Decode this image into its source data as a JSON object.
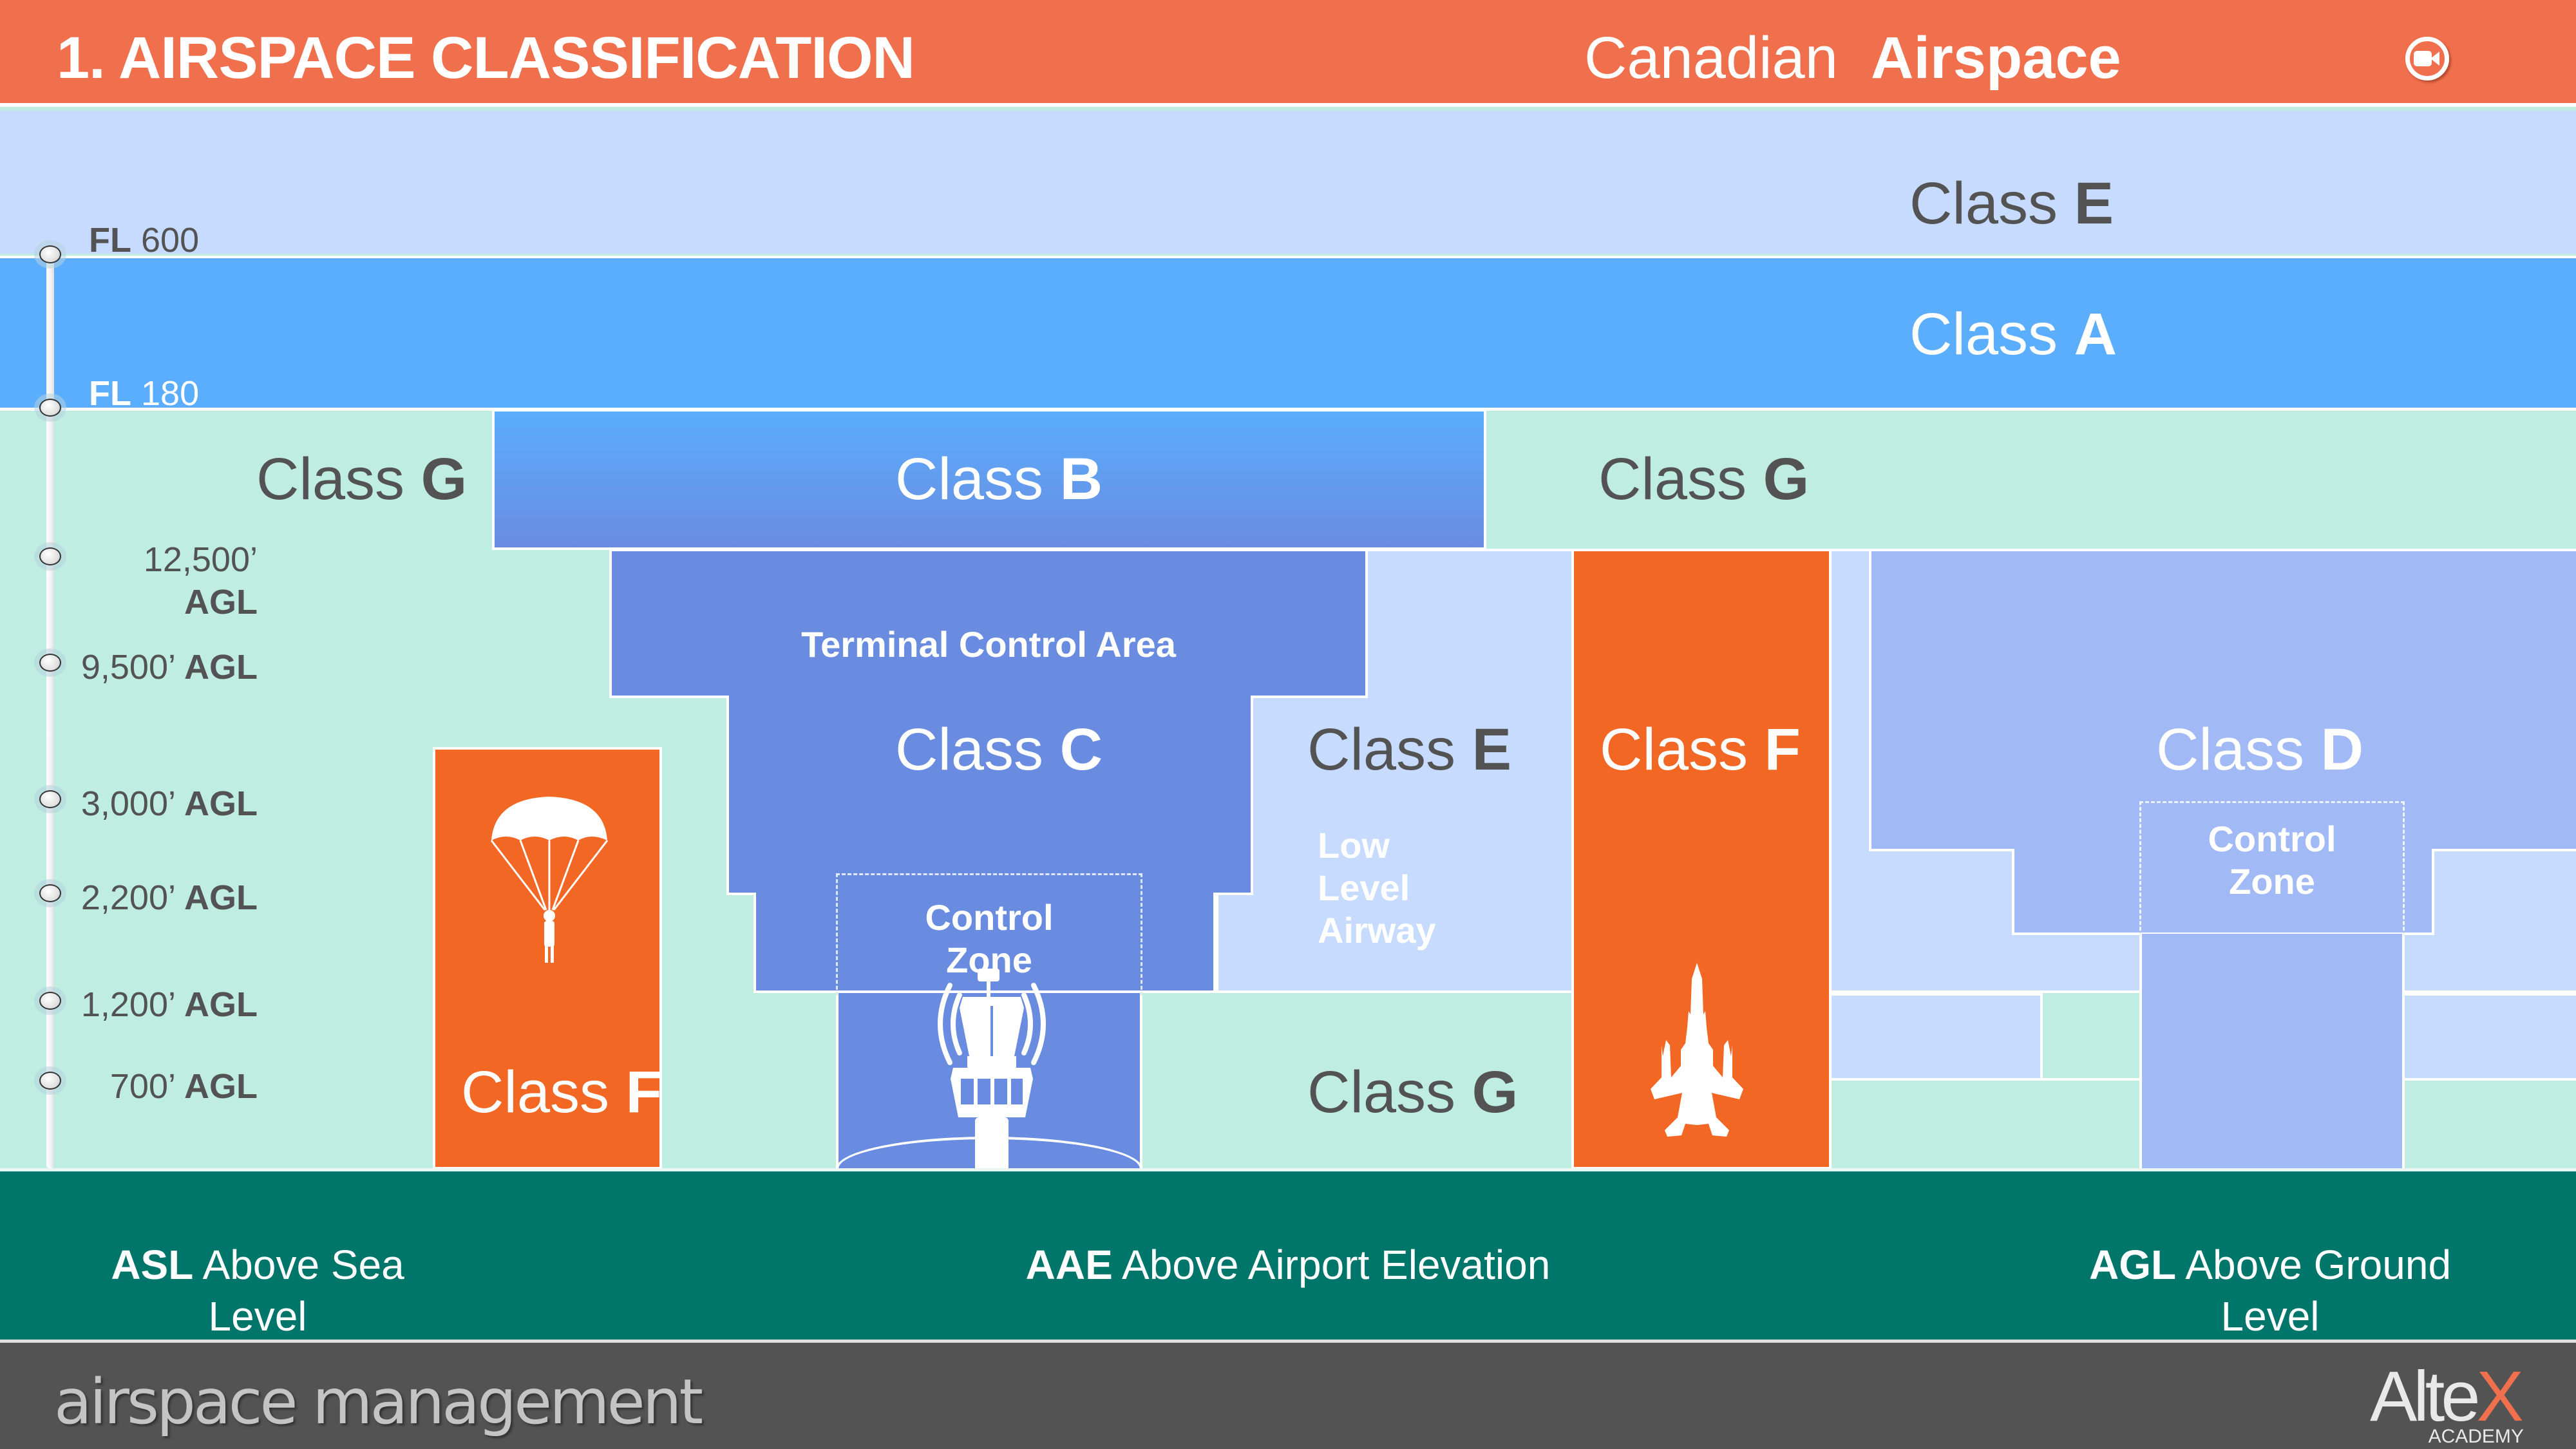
{
  "header": {
    "title": "1. AIRSPACE CLASSIFICATION",
    "subtitle_light": "Canadian",
    "subtitle_bold": "Airspace",
    "video_button_icon": "video-camera-icon"
  },
  "altitude_scale": [
    {
      "value": "FL",
      "suffix": "600",
      "bold_first": true
    },
    {
      "value": "FL",
      "suffix": "180",
      "bold_first": true
    },
    {
      "value": "12,500’",
      "suffix": "AGL",
      "bold_first": false
    },
    {
      "value": "9,500’",
      "suffix": "AGL",
      "bold_first": false
    },
    {
      "value": "3,000’",
      "suffix": "AGL",
      "bold_first": false
    },
    {
      "value": "2,200’",
      "suffix": "AGL",
      "bold_first": false
    },
    {
      "value": "1,200’",
      "suffix": "AGL",
      "bold_first": false
    },
    {
      "value": "700’",
      "suffix": "AGL",
      "bold_first": false
    }
  ],
  "classes": {
    "class_word": "Class",
    "upper_e": "E",
    "a": "A",
    "g_left": "G",
    "b": "B",
    "g_right": "G",
    "tca_label": "Terminal Control Area",
    "c": "C",
    "e_mid": "E",
    "f_mid": "F",
    "d": "D",
    "f_left": "F",
    "g_low": "G",
    "low_level_airway": [
      "Low",
      "Level",
      "Airway"
    ],
    "control_zone": [
      "Control",
      "Zone"
    ]
  },
  "icons": {
    "parachute": "parachute-icon",
    "tower": "control-tower-icon",
    "jet": "fighter-jet-icon"
  },
  "legend": [
    {
      "abbr": "ASL",
      "line1": "Above Sea",
      "line2": "Level"
    },
    {
      "abbr": "AAE",
      "line1": "Above Airport Elevation",
      "line2": ""
    },
    {
      "abbr": "AGL",
      "line1": "Above Ground",
      "line2": "Level"
    }
  ],
  "footer": {
    "topic": "airspace management",
    "logo_main": "Alte",
    "logo_x": "X",
    "logo_sub": "ACADEMY"
  },
  "colors": {
    "header": "#f0704d",
    "class_e": "#c7dbfe",
    "class_a": "#5badfd",
    "class_g": "#bfede2",
    "class_c": "#698ce0",
    "class_d": "#a1b9f5",
    "class_f": "#f26724",
    "ground": "#00756a",
    "footer": "#535353"
  }
}
